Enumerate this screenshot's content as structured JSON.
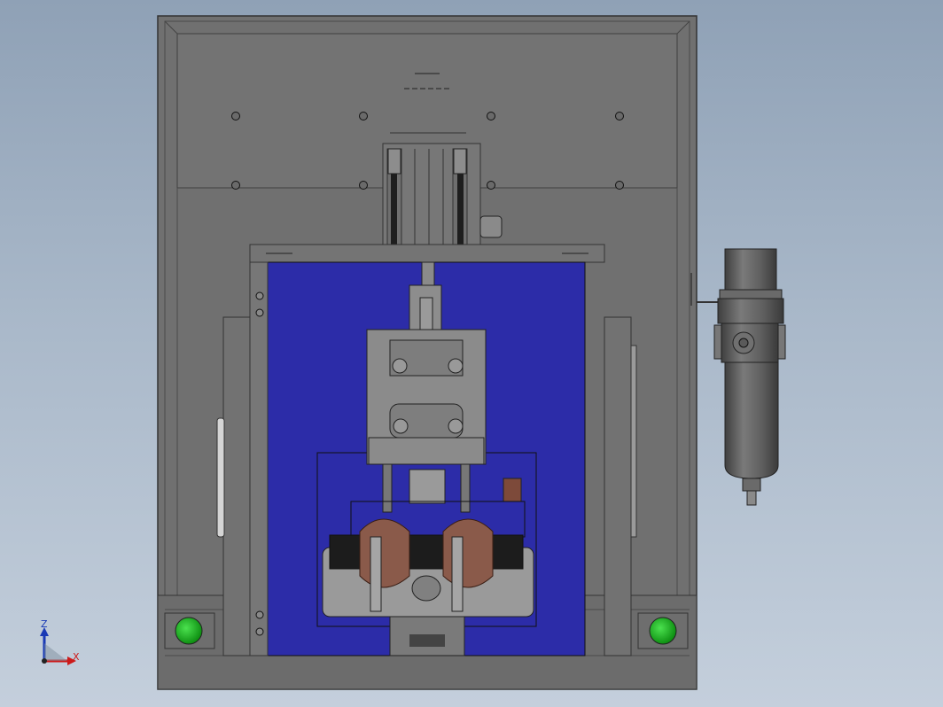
{
  "viewport": {
    "background_top": "#8fa1b6",
    "background_bottom": "#c4cfdc"
  },
  "machine": {
    "frame_color": "#6f6f6f",
    "frame_edge": "#3a3a3a",
    "blue_panel_color": "#2c2ca8",
    "coil_color": "#8a5a4a",
    "indicator_color": "#19b31f",
    "filter_color": "#5a5a5a"
  },
  "triad": {
    "z_label": "Z",
    "x_label": "X",
    "z_color": "#1a3ab5",
    "x_color": "#cc1a1a"
  }
}
